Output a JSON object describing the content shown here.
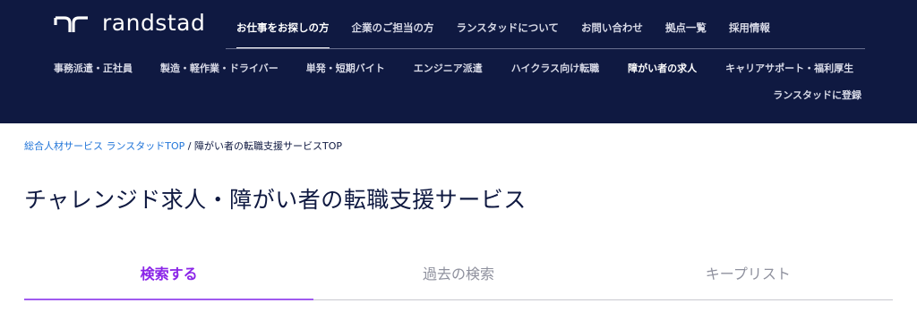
{
  "header": {
    "logo_text": "randstad",
    "logo_icon": "randstad-logo-mark",
    "background": "#0f1941",
    "top_nav": [
      {
        "label": "お仕事をお探しの方",
        "active": true
      },
      {
        "label": "企業のご担当の方"
      },
      {
        "label": "ランスタッドについて"
      },
      {
        "label": "お問い合わせ"
      },
      {
        "label": "拠点一覧"
      },
      {
        "label": "採用情報"
      }
    ],
    "sub_nav": [
      {
        "label": "事務派遣・正社員"
      },
      {
        "label": "製造・軽作業・ドライバー"
      },
      {
        "label": "単発・短期バイト"
      },
      {
        "label": "エンジニア派遣"
      },
      {
        "label": "ハイクラス向け転職"
      },
      {
        "label": "障がい者の求人",
        "active": true
      },
      {
        "label": "キャリアサポート・福利厚生"
      }
    ],
    "register_label": "ランスタッドに登録"
  },
  "breadcrumb": {
    "link": "総合人材サービス ランスタッドTOP",
    "separator": "/",
    "current": "障がい者の転職支援サービスTOP"
  },
  "page_title": "チャレンジド求人・障がい者の転職支援サービス",
  "tabs": [
    {
      "label": "検索する",
      "active": true
    },
    {
      "label": "過去の検索"
    },
    {
      "label": "キープリスト"
    }
  ],
  "colors": {
    "navy": "#0f1941",
    "link_blue": "#2175d9",
    "tab_active": "#8b25e8"
  }
}
